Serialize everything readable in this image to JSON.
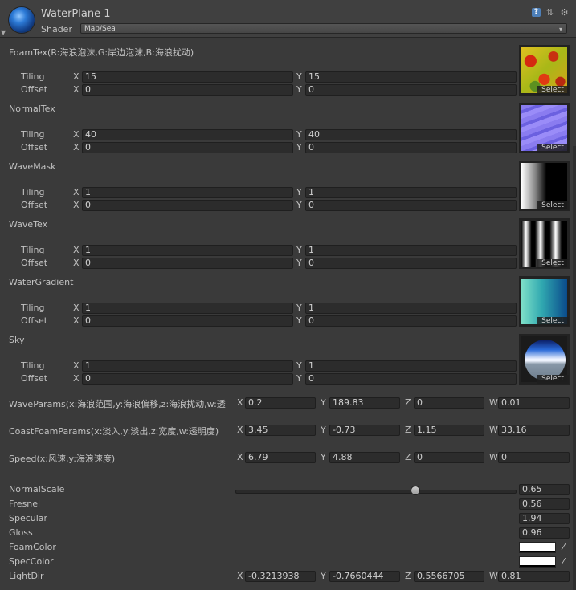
{
  "material": {
    "name": "WaterPlane 1",
    "shader_label": "Shader",
    "shader_value": "Map/Sea",
    "icons": [
      "help-icon",
      "preset-icon",
      "settings-gear-icon"
    ]
  },
  "labels": {
    "tiling": "Tiling",
    "offset": "Offset",
    "x": "X",
    "y": "Y",
    "z": "Z",
    "w": "W",
    "select": "Select"
  },
  "textures": [
    {
      "name": "FoamTex(R:海浪泡沫,G:岸边泡沫,B:海浪扰动)",
      "tiling_x": "15",
      "tiling_y": "15",
      "offset_x": "0",
      "offset_y": "0"
    },
    {
      "name": "NormalTex",
      "tiling_x": "40",
      "tiling_y": "40",
      "offset_x": "0",
      "offset_y": "0"
    },
    {
      "name": "WaveMask",
      "tiling_x": "1",
      "tiling_y": "1",
      "offset_x": "0",
      "offset_y": "0"
    },
    {
      "name": "WaveTex",
      "tiling_x": "1",
      "tiling_y": "1",
      "offset_x": "0",
      "offset_y": "0"
    },
    {
      "name": "WaterGradient",
      "tiling_x": "1",
      "tiling_y": "1",
      "offset_x": "0",
      "offset_y": "0"
    },
    {
      "name": "Sky",
      "tiling_x": "1",
      "tiling_y": "1",
      "offset_x": "0",
      "offset_y": "0"
    }
  ],
  "vectors": [
    {
      "name": "WaveParams(x:海浪范围,y:海浪偏移,z:海浪扰动,w:透",
      "x": "0.2",
      "y": "189.83",
      "z": "0",
      "w": "0.01"
    },
    {
      "name": "CoastFoamParams(x:淡入,y:淡出,z:宽度,w:透明度)",
      "x": "3.45",
      "y": "-0.73",
      "z": "1.15",
      "w": "33.16"
    },
    {
      "name": "Speed(x:风速,y:海浪速度)",
      "x": "6.79",
      "y": "4.88",
      "z": "0",
      "w": "0"
    }
  ],
  "floats": {
    "normal_scale": {
      "label": "NormalScale",
      "value": "0.65",
      "slider_fraction": 0.64
    },
    "fresnel": {
      "label": "Fresnel",
      "value": "0.56"
    },
    "specular": {
      "label": "Specular",
      "value": "1.94"
    },
    "gloss": {
      "label": "Gloss",
      "value": "0.96"
    }
  },
  "colors": {
    "foam_color": {
      "label": "FoamColor",
      "hex": "#ffffff"
    },
    "spec_color": {
      "label": "SpecColor",
      "hex": "#ffffff"
    }
  },
  "light_dir": {
    "label": "LightDir",
    "x": "-0.3213938",
    "y": "-0.7660444",
    "z": "0.5566705",
    "w": "0.81"
  }
}
